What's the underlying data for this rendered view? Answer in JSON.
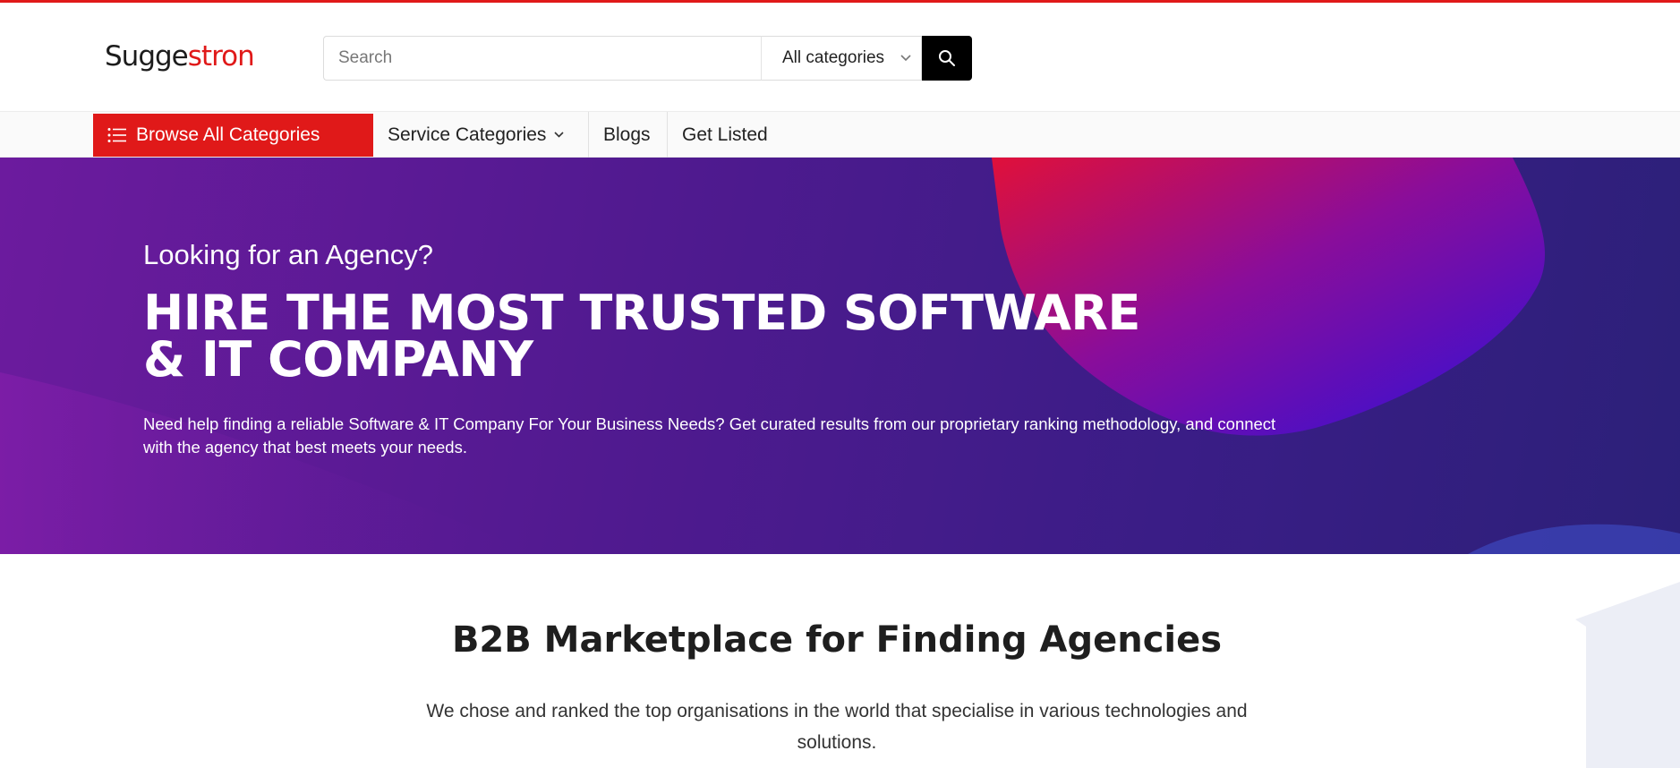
{
  "header": {
    "logo": {
      "part1": "Sugge",
      "part2": "stron"
    },
    "search": {
      "placeholder": "Search",
      "value": ""
    },
    "category_select": {
      "selected": "All categories"
    }
  },
  "nav": {
    "browse_label": "Browse All Categories",
    "items": [
      {
        "label": "Service Categories",
        "has_dropdown": true
      },
      {
        "label": "Blogs"
      },
      {
        "label": "Get Listed"
      }
    ]
  },
  "hero": {
    "subtitle": "Looking for an Agency?",
    "title": "HIRE THE MOST TRUSTED SOFTWARE & IT COMPANY",
    "description": "Need help finding a reliable Software & IT Company For Your Business Needs? Get curated results from our proprietary ranking methodology, and connect with the agency that best meets your needs."
  },
  "section": {
    "title": "B2B Marketplace for Finding Agencies",
    "description": "We chose and ranked the top organisations in the world that specialise in various technologies and solutions."
  },
  "colors": {
    "accent": "#e01919",
    "hero_start": "#6c1b9e",
    "hero_end": "#2c2079",
    "search_button": "#000000"
  },
  "icons": {
    "browse": "list-icon",
    "search": "search-icon",
    "dropdown": "chevron-down-icon"
  }
}
